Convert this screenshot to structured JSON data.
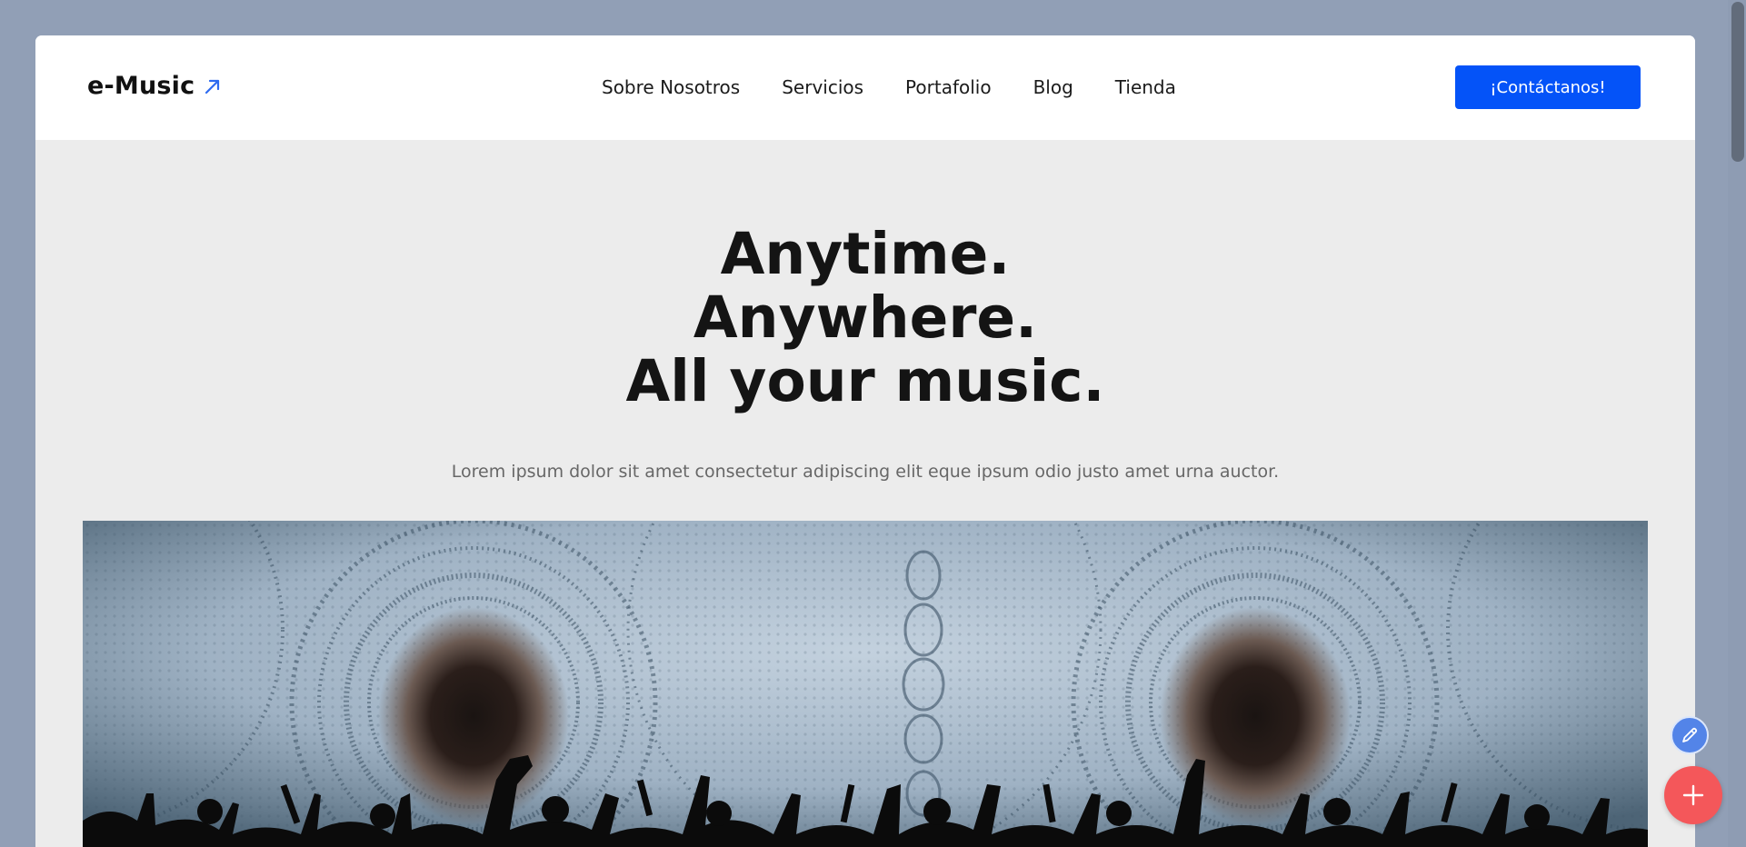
{
  "header": {
    "logo_text": "e-Music",
    "logo_icon": "arrow-up-right-icon",
    "nav": [
      {
        "label": "Sobre Nosotros"
      },
      {
        "label": "Servicios"
      },
      {
        "label": "Portafolio"
      },
      {
        "label": "Blog"
      },
      {
        "label": "Tienda"
      }
    ],
    "cta_label": "¡Contáctanos!"
  },
  "hero": {
    "title_lines": [
      "Anytime.",
      "Anywhere.",
      "All your music."
    ],
    "subtitle": "Lorem ipsum dolor sit amet consectetur adipiscing elit eque ipsum odio justo amet urna auctor."
  },
  "floating_actions": {
    "edit_icon": "pencil-icon",
    "add_icon": "plus-icon"
  },
  "colors": {
    "page_background": "#919fb6",
    "accent": "#0453f8",
    "fab_add": "#f4575a",
    "fab_edit": "#5384e8"
  }
}
